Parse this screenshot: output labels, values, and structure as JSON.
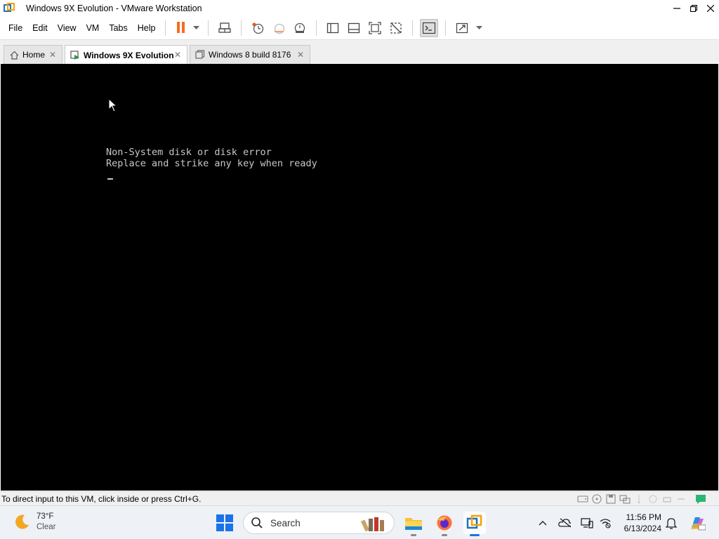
{
  "window": {
    "title": "Windows 9X Evolution - VMware Workstation",
    "controls": {
      "minimize": "—",
      "restore": "❐",
      "close": "✕"
    }
  },
  "menu": {
    "items": [
      {
        "label": "File",
        "mnemonic": "F"
      },
      {
        "label": "Edit",
        "mnemonic": "E"
      },
      {
        "label": "View",
        "mnemonic": "V"
      },
      {
        "label": "VM",
        "mnemonic": "M"
      },
      {
        "label": "Tabs",
        "mnemonic": "T"
      },
      {
        "label": "Help",
        "mnemonic": "H"
      }
    ]
  },
  "toolbar": {
    "accent_pause": "#f26f21",
    "icons": [
      "pause-icon",
      "send-ctrl-alt-del-icon",
      "snapshot-icon",
      "revert-snapshot-icon",
      "snapshot-manager-icon",
      "show-library-icon",
      "thumbnail-bar-icon",
      "full-screen-icon",
      "unity-icon",
      "console-view-icon",
      "stretch-guest-icon"
    ]
  },
  "tabs": [
    {
      "label": "Home",
      "icon": "home-icon",
      "active": false
    },
    {
      "label": "Windows 9X Evolution",
      "icon": "vm-running-icon",
      "active": true
    },
    {
      "label": "Windows 8 build 8176",
      "icon": "vm-icon",
      "active": false
    }
  ],
  "tab_close": "✕",
  "console": {
    "line1": "Non-System disk or disk error",
    "line2": "Replace and strike any key when ready",
    "background": "#000000",
    "text_color": "#c8c8c8"
  },
  "status": {
    "hint": "To direct input to this VM, click inside or press Ctrl+G."
  },
  "taskbar": {
    "weather": {
      "temp": "73°F",
      "condition": "Clear"
    },
    "search_label": "Search",
    "clock": {
      "time": "11:56 PM",
      "date": "6/13/2024"
    },
    "start_color": "#1a73e8"
  }
}
